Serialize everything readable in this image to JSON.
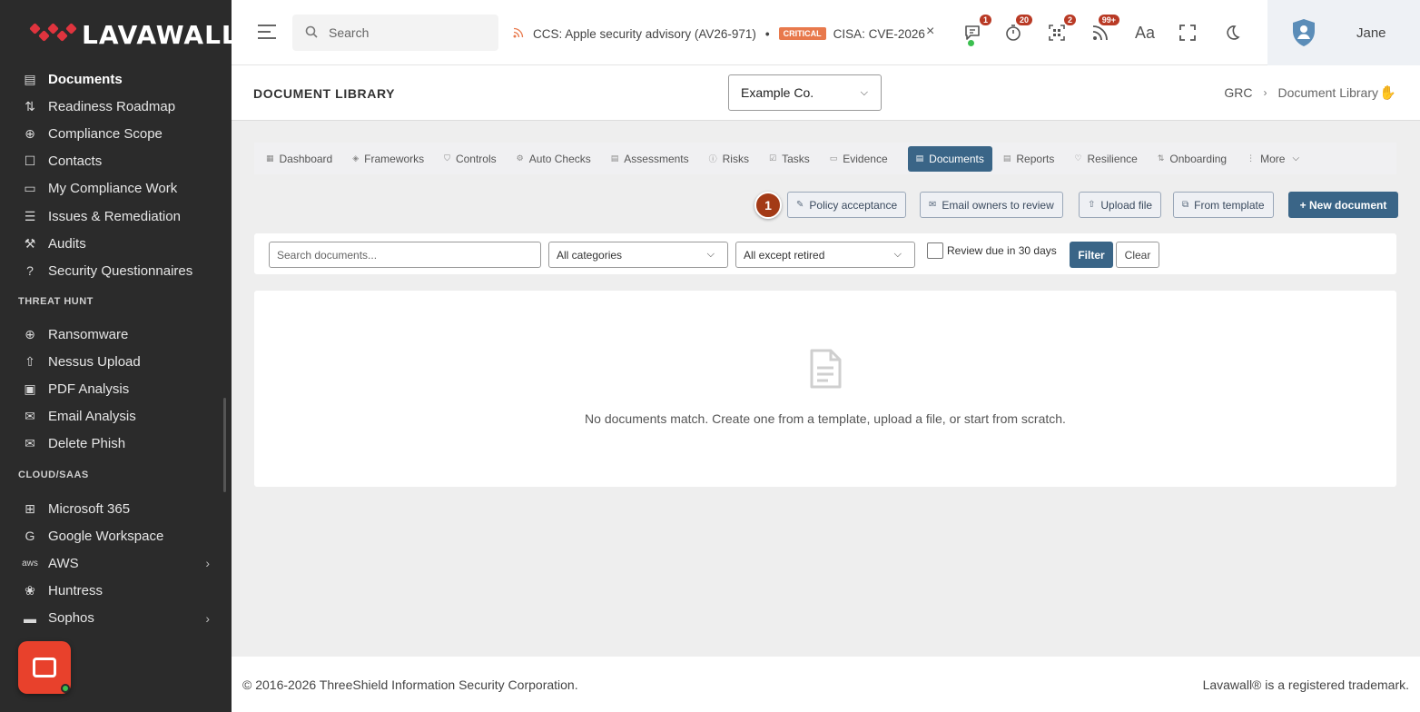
{
  "brand": {
    "name_part1": "LAVA",
    "name_part2": "WALL",
    "reg": "®",
    "colors": {
      "accent": "#3a6587",
      "logo_red": "#e0343e",
      "badge": "#b93a25",
      "chat": "#e8412c"
    }
  },
  "sidebar": {
    "items_main": [
      {
        "label": "Documents",
        "icon": "documents-icon"
      },
      {
        "label": "Readiness Roadmap",
        "icon": "roadmap-icon"
      },
      {
        "label": "Compliance Scope",
        "icon": "scope-icon"
      },
      {
        "label": "Contacts",
        "icon": "contacts-icon"
      },
      {
        "label": "My Compliance Work",
        "icon": "inbox-icon"
      },
      {
        "label": "Issues & Remediation",
        "icon": "list-icon"
      },
      {
        "label": "Audits",
        "icon": "gavel-icon"
      },
      {
        "label": "Security Questionnaires",
        "icon": "question-icon"
      }
    ],
    "section_threat": "THREAT HUNT",
    "items_threat": [
      {
        "label": "Ransomware",
        "icon": "crosshair-icon"
      },
      {
        "label": "Nessus Upload",
        "icon": "upload-icon"
      },
      {
        "label": "PDF Analysis",
        "icon": "pdf-icon"
      },
      {
        "label": "Email Analysis",
        "icon": "email-check-icon"
      },
      {
        "label": "Delete Phish",
        "icon": "email-x-icon"
      }
    ],
    "section_cloud": "CLOUD/SAAS",
    "items_cloud": [
      {
        "label": "Microsoft 365",
        "icon": "windows-icon"
      },
      {
        "label": "Google Workspace",
        "icon": "google-icon"
      },
      {
        "label": "AWS",
        "icon": "aws-icon"
      },
      {
        "label": "Huntress",
        "icon": "huntress-icon"
      },
      {
        "label": "Sophos",
        "icon": "sophos-icon"
      }
    ]
  },
  "topbar": {
    "search_placeholder": "Search",
    "ticker_item1": "CCS: Apple security advisory (AV26-971)",
    "ticker_sep": "•",
    "ticker_badge": "CRITICAL",
    "ticker_item2": "CISA: CVE-2026",
    "close": "×",
    "badges": {
      "messages": "1",
      "timer": "20",
      "qr": "2",
      "feeds": "99+"
    },
    "font_icon_text": "Aa",
    "user_name": "Jane"
  },
  "page_header": {
    "title": "DOCUMENT LIBRARY",
    "org_selected": "Example Co.",
    "breadcrumb": [
      "GRC",
      "Document Library"
    ]
  },
  "tabs": [
    {
      "label": "Dashboard",
      "icon": "dashboard-icon"
    },
    {
      "label": "Frameworks",
      "icon": "layers-icon"
    },
    {
      "label": "Controls",
      "icon": "shield-icon"
    },
    {
      "label": "Auto Checks",
      "icon": "gear-check-icon"
    },
    {
      "label": "Assessments",
      "icon": "clipboard-icon"
    },
    {
      "label": "Risks",
      "icon": "alert-icon"
    },
    {
      "label": "Tasks",
      "icon": "checkbox-icon"
    },
    {
      "label": "Evidence",
      "icon": "folder-icon"
    },
    {
      "label": "Documents",
      "icon": "documents-icon",
      "active": true
    },
    {
      "label": "Reports",
      "icon": "report-icon"
    },
    {
      "label": "Resilience",
      "icon": "heart-icon"
    },
    {
      "label": "Onboarding",
      "icon": "route-icon"
    },
    {
      "label": "More",
      "icon": "dots-icon"
    }
  ],
  "actions": {
    "step_marker": "1",
    "policy_acceptance": "Policy acceptance",
    "email_owners": "Email owners to review",
    "upload_file": "Upload file",
    "from_template": "From template",
    "new_document": "+ New document"
  },
  "filters": {
    "search_placeholder": "Search documents...",
    "category": "All categories",
    "status": "All except retired",
    "review_label": "Review due in 30 days",
    "filter_btn": "Filter",
    "clear_btn": "Clear"
  },
  "empty_state": {
    "message": "No documents match. Create one from a template, upload a file, or start from scratch."
  },
  "footer": {
    "copyright": "© 2016-2026 ThreeShield Information Security Corporation.",
    "trademark": "Lavawall® is a registered trademark."
  }
}
